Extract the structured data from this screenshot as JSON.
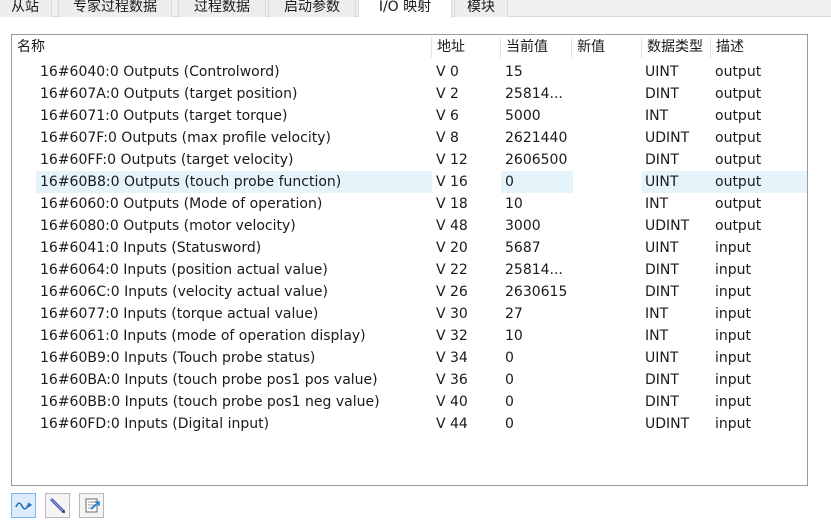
{
  "tabs": [
    "从站",
    "专家过程数据",
    "过程数据",
    "启动参数",
    "I/O 映射",
    "模块"
  ],
  "active_tab": "I/O 映射",
  "columns": [
    "名称",
    "地址",
    "当前值",
    "新值",
    "数据类型",
    "描述"
  ],
  "rows": [
    {
      "name": "16#6040:0 Outputs (Controlword)",
      "addr": "V 0",
      "cur": "15",
      "new": "",
      "type": "UINT",
      "desc": "output"
    },
    {
      "name": "16#607A:0 Outputs (target position)",
      "addr": "V 2",
      "cur": "25814...",
      "new": "",
      "type": "DINT",
      "desc": "output"
    },
    {
      "name": "16#6071:0 Outputs (target torque)",
      "addr": "V 6",
      "cur": "5000",
      "new": "",
      "type": "INT",
      "desc": "output"
    },
    {
      "name": "16#607F:0 Outputs (max profile velocity)",
      "addr": "V 8",
      "cur": "2621440",
      "new": "",
      "type": "UDINT",
      "desc": "output"
    },
    {
      "name": "16#60FF:0 Outputs (target velocity)",
      "addr": "V 12",
      "cur": "2606500",
      "new": "",
      "type": "DINT",
      "desc": "output"
    },
    {
      "name": "16#60B8:0 Outputs (touch probe function)",
      "addr": "V 16",
      "cur": "0",
      "new": "",
      "type": "UINT",
      "desc": "output"
    },
    {
      "name": "16#6060:0 Outputs (Mode of operation)",
      "addr": "V 18",
      "cur": "10",
      "new": "",
      "type": "INT",
      "desc": "output"
    },
    {
      "name": "16#6080:0 Outputs (motor velocity)",
      "addr": "V 48",
      "cur": "3000",
      "new": "",
      "type": "UDINT",
      "desc": "output"
    },
    {
      "name": "16#6041:0 Inputs (Statusword)",
      "addr": "V 20",
      "cur": "5687",
      "new": "",
      "type": "UINT",
      "desc": "input"
    },
    {
      "name": "16#6064:0 Inputs (position actual value)",
      "addr": "V 22",
      "cur": "25814...",
      "new": "",
      "type": "DINT",
      "desc": "input"
    },
    {
      "name": "16#606C:0 Inputs (velocity actual value)",
      "addr": "V 26",
      "cur": "2630615",
      "new": "",
      "type": "DINT",
      "desc": "input"
    },
    {
      "name": "16#6077:0 Inputs (torque actual value)",
      "addr": "V 30",
      "cur": "27",
      "new": "",
      "type": "INT",
      "desc": "input"
    },
    {
      "name": "16#6061:0 Inputs (mode of operation display)",
      "addr": "V 32",
      "cur": "10",
      "new": "",
      "type": "INT",
      "desc": "input"
    },
    {
      "name": "16#60B9:0 Inputs (Touch probe status)",
      "addr": "V 34",
      "cur": "0",
      "new": "",
      "type": "UINT",
      "desc": "input"
    },
    {
      "name": "16#60BA:0 Inputs (touch probe pos1 pos value)",
      "addr": "V 36",
      "cur": "0",
      "new": "",
      "type": "DINT",
      "desc": "input"
    },
    {
      "name": "16#60BB:0 Inputs (touch probe pos1 neg value)",
      "addr": "V 40",
      "cur": "0",
      "new": "",
      "type": "DINT",
      "desc": "input"
    },
    {
      "name": "16#60FD:0 Inputs (Digital input)",
      "addr": "V 44",
      "cur": "0",
      "new": "",
      "type": "UDINT",
      "desc": "input"
    }
  ],
  "selected_row": 5,
  "toolbar": [
    {
      "icon": "wave-signal-icon",
      "active": true
    },
    {
      "icon": "pencil-edit-icon",
      "active": false
    },
    {
      "icon": "export-document-icon",
      "active": false
    }
  ],
  "colors": {
    "selection": "#e5f3fb",
    "tab_bg": "#ededed",
    "border": "#9a9a9a"
  }
}
